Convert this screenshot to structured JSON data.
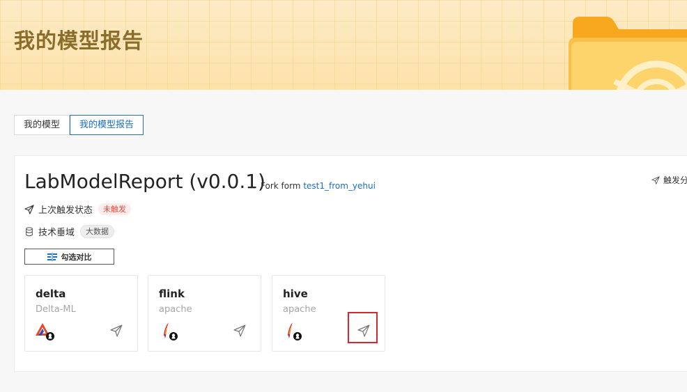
{
  "banner": {
    "title": "我的模型报告"
  },
  "tabs": [
    {
      "label": "我的模型"
    },
    {
      "label": "我的模型报告"
    }
  ],
  "report": {
    "title": "LabModelReport (v0.0.1)",
    "fork_prefix": "Fork form",
    "fork_link": "test1_from_yehui",
    "trigger_label": "触发分",
    "last_trigger_label": "上次触发状态",
    "last_trigger_status": "未触发",
    "domain_label": "技术垂域",
    "domain_value": "大数据",
    "compare_label": "勾选对比"
  },
  "cards": [
    {
      "name": "delta",
      "sub": "Delta-ML",
      "logo": "delta-github-logo"
    },
    {
      "name": "flink",
      "sub": "apache",
      "logo": "apache-github-logo"
    },
    {
      "name": "hive",
      "sub": "apache",
      "logo": "apache-github-logo"
    }
  ],
  "colors": {
    "accent": "#1a6fc4",
    "banner_title": "#8a6d2a",
    "status_red": "#e24b3c",
    "highlight": "#d9262b"
  }
}
